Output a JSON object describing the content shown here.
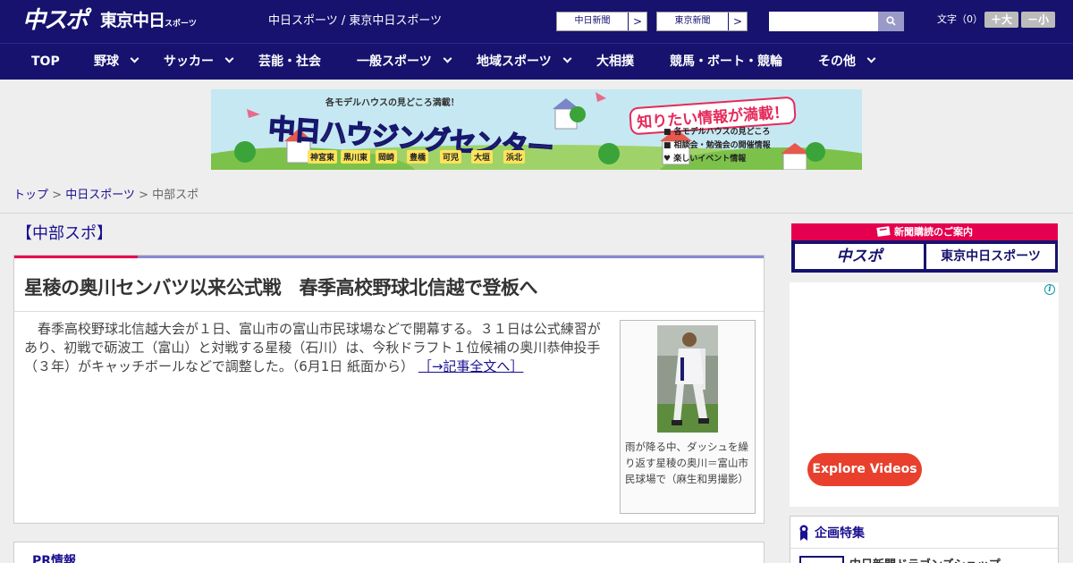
{
  "header": {
    "logo_main": "中スポ",
    "logo_tokyo": "東京中日",
    "logo_tokyo_small": "スポーツ",
    "site_name": "中日スポーツ / 東京中日スポーツ",
    "paper_buttons": [
      {
        "label": "中日新聞",
        "arrow": ">"
      },
      {
        "label": "東京新聞",
        "arrow": ">"
      }
    ],
    "search": {
      "value": "",
      "placeholder": ""
    },
    "font_size_label": "文字（0）",
    "font_plus": "＋大",
    "font_minus": "－小"
  },
  "nav": {
    "items": [
      {
        "label": "TOP",
        "dropdown": false
      },
      {
        "label": "野球",
        "dropdown": true
      },
      {
        "label": "サッカー",
        "dropdown": true
      },
      {
        "label": "芸能・社会",
        "dropdown": false
      },
      {
        "label": "一般スポーツ",
        "dropdown": true
      },
      {
        "label": "地域スポーツ",
        "dropdown": true
      },
      {
        "label": "大相撲",
        "dropdown": false
      },
      {
        "label": "競馬・ボート・競輪",
        "dropdown": false
      },
      {
        "label": "その他",
        "dropdown": true
      }
    ]
  },
  "banner": {
    "top_text": "各モデルハウスの見どころ満載！",
    "title": "中日ハウジングセンター",
    "badge": "知りたい情報が満載！",
    "bullets": [
      "各モデルハウスの見どころ",
      "相談会・勉強会の開催情報",
      "楽しいイベント情報"
    ],
    "locations": [
      "神宮東",
      "黒川東",
      "岡崎",
      "豊橋",
      "可児",
      "大垣",
      "浜北"
    ]
  },
  "breadcrumb": {
    "home": "トップ",
    "sep1": " > ",
    "section": "中日スポーツ",
    "sep2": " > ",
    "current": "中部スポ"
  },
  "category_title": "【中部スポ】",
  "article": {
    "title": "星稜の奥川センバツ以来公式戦　春季高校野球北信越で登板へ",
    "body": "　春季高校野球北信越大会が１日、富山市の富山市民球場などで開幕する。３１日は公式練習があり、初戦で砺波工（富山）と対戦する星稜（石川）は、今秋ドラフト１位候補の奥川恭伸投手（３年）がキャッチボールなどで調整した。（6月1日 紙面から）",
    "more_link": "［→記事全文へ］",
    "photo_caption": "雨が降る中、ダッシュを繰り返す星稜の奥川＝富山市民球場で（麻生和男撮影）"
  },
  "pr_title": "PR情報",
  "sidebar": {
    "subscribe_header": "新聞購読のご案内",
    "subscribe_buttons": [
      "中スポ",
      "東京中日スポーツ"
    ],
    "ad_button": "Explore Videos",
    "ad_info_icon": "i",
    "feature_title": "企画特集",
    "feature_item": "中日新聞ドラゴンズショップ"
  },
  "colors": {
    "header_bg": "#16126e",
    "accent_red": "#e5004f",
    "link": "#1a1090",
    "ad_button": "#e8402d"
  }
}
